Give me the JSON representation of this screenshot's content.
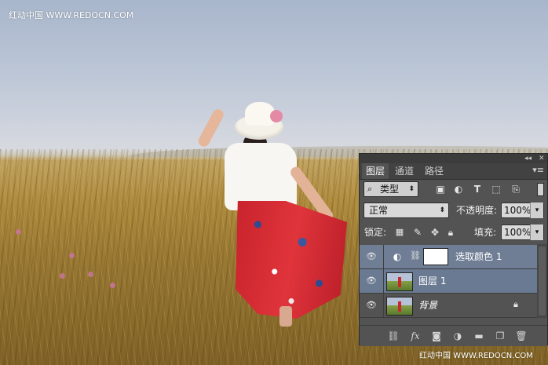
{
  "watermark": {
    "top": "红动中国 WWW.REDOCN.COM",
    "bottom": "红动中国 WWW.REDOCN.COM"
  },
  "panel": {
    "titlebar": {
      "collapse_icon": "double-chevron-left-icon",
      "close_icon": "close-icon"
    },
    "tabs": [
      {
        "label": "图层",
        "active": true
      },
      {
        "label": "通道",
        "active": false
      },
      {
        "label": "路径",
        "active": false
      }
    ],
    "filter": {
      "kind_label": "类型",
      "filter_icons": [
        "image-filter-icon",
        "adjustment-filter-icon",
        "type-filter-icon",
        "shape-filter-icon",
        "smart-object-filter-icon"
      ]
    },
    "blend": {
      "mode": "正常",
      "opacity_label": "不透明度:",
      "opacity_value": "100%"
    },
    "lock": {
      "label": "锁定:",
      "fill_label": "填充:",
      "fill_value": "100%"
    },
    "layers": [
      {
        "name": "选取颜色 1",
        "type": "adjustment",
        "selected": true
      },
      {
        "name": "图层 1",
        "type": "pixel",
        "selected": true
      },
      {
        "name": "背景",
        "type": "background",
        "selected": false,
        "locked": true
      }
    ],
    "footer_icons": [
      "link-layers-icon",
      "fx-icon",
      "add-mask-icon",
      "new-adjustment-icon",
      "new-group-icon",
      "new-layer-icon",
      "trash-icon"
    ]
  },
  "colors": {
    "panel_bg": "#535353",
    "selected_row": "#6f7e95",
    "tab_bar": "#424242"
  }
}
